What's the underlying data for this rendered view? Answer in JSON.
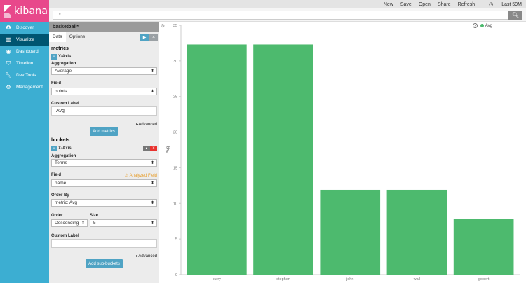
{
  "app": {
    "name": "kibana"
  },
  "nav": {
    "items": [
      {
        "label": "Discover",
        "icon": "compass-icon",
        "active": false
      },
      {
        "label": "Visualize",
        "icon": "bar-chart-icon",
        "active": true
      },
      {
        "label": "Dashboard",
        "icon": "dashboard-icon",
        "active": false
      },
      {
        "label": "Timelion",
        "icon": "shield-icon",
        "active": false
      },
      {
        "label": "Dev Tools",
        "icon": "wrench-icon",
        "active": false
      },
      {
        "label": "Management",
        "icon": "gear-icon",
        "active": false
      }
    ]
  },
  "topbar": {
    "new": "New",
    "save": "Save",
    "open": "Open",
    "share": "Share",
    "refresh": "Refresh",
    "time": "Last 59M"
  },
  "query": {
    "value": "*"
  },
  "editor": {
    "title": "basketball*",
    "tabs": {
      "data": "Data",
      "options": "Options"
    },
    "metrics": {
      "heading": "metrics",
      "axis_label": "Y-Axis",
      "aggregation_label": "Aggregation",
      "aggregation_value": "Average",
      "field_label": "Field",
      "field_value": "points",
      "custom_label_label": "Custom Label",
      "custom_label_value": "Avg",
      "advanced": "Advanced",
      "add_button": "Add metrics"
    },
    "buckets": {
      "heading": "buckets",
      "axis_label": "X-Axis",
      "aggregation_label": "Aggregation",
      "aggregation_value": "Terms",
      "field_label": "Field",
      "analyzed_warning": "Analyzed Field",
      "field_value": "name",
      "order_by_label": "Order By",
      "order_by_value": "metric: Avg",
      "order_label": "Order",
      "order_value": "Descending",
      "size_label": "Size",
      "size_value": "5",
      "custom_label_label": "Custom Label",
      "custom_label_value": "",
      "advanced": "Advanced",
      "add_button": "Add sub-buckets"
    }
  },
  "chart_data": {
    "type": "bar",
    "categories": [
      "curry",
      "stephen",
      "john",
      "wall",
      "gobert"
    ],
    "series": [
      {
        "name": "Avg",
        "values": [
          32.3,
          32.3,
          11.9,
          11.9,
          7.8
        ],
        "color": "#4dba6e"
      }
    ],
    "xlabel": "",
    "ylabel": "Avg",
    "ylim": [
      0,
      35
    ],
    "yticks": [
      0,
      5,
      10,
      15,
      20,
      25,
      30,
      35
    ],
    "legend": "top-right",
    "grid": false
  }
}
